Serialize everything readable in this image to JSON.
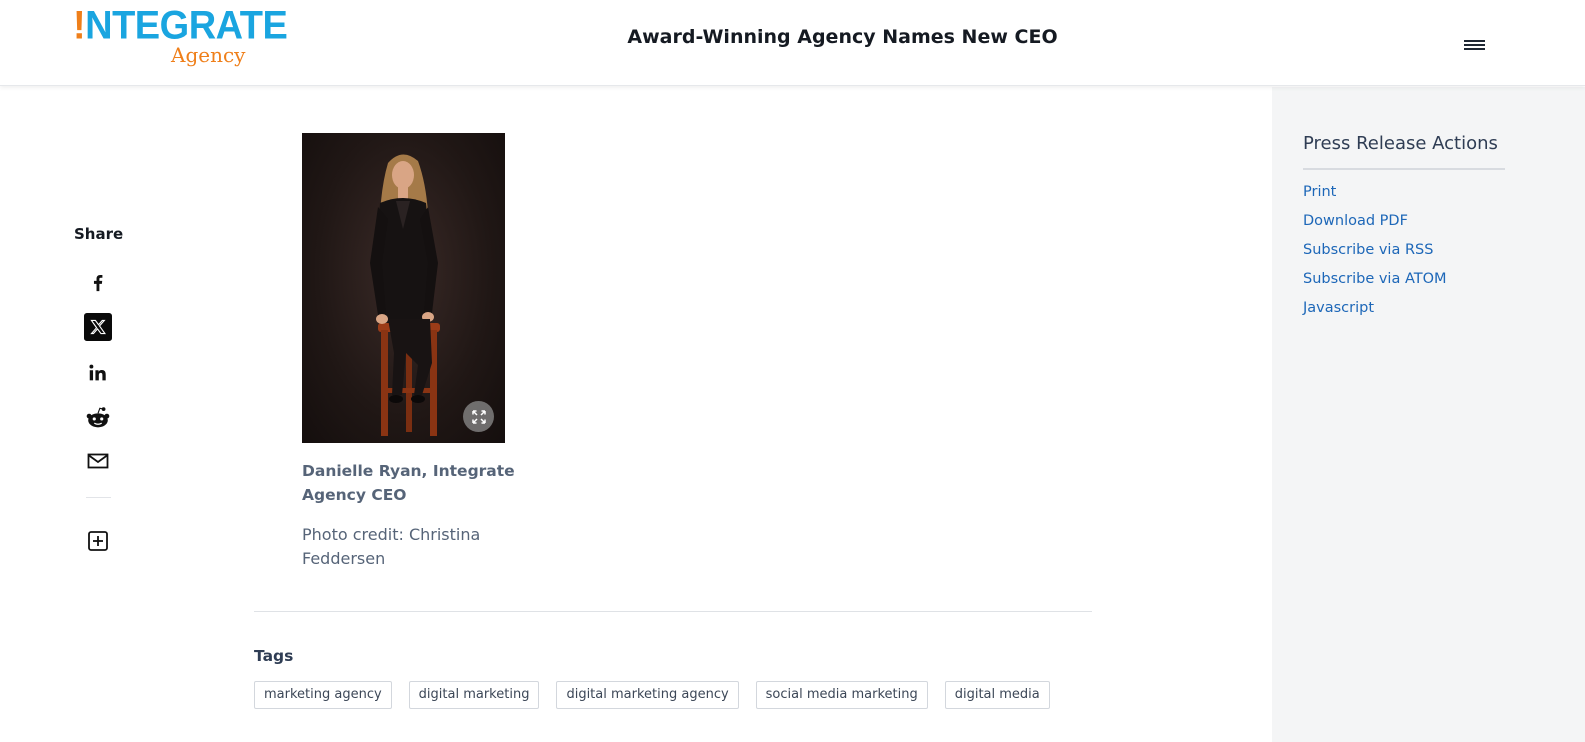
{
  "header": {
    "logo": {
      "bang": "!",
      "main": "NTEGRATE",
      "sub": "Agency"
    },
    "page_title": "Award-Winning Agency Names New CEO",
    "menu_icon": "hamburger-menu-icon"
  },
  "share": {
    "label": "Share",
    "icons": [
      "facebook-icon",
      "x-twitter-icon",
      "linkedin-icon",
      "reddit-icon",
      "email-icon",
      "add-more-icon"
    ]
  },
  "media": {
    "caption": "Danielle Ryan, Integrate Agency CEO",
    "credit": "Photo credit: Christina Feddersen",
    "expand_icon": "expand-icon"
  },
  "tags": {
    "title": "Tags",
    "items": [
      "marketing agency",
      "digital marketing",
      "digital marketing agency",
      "social media marketing",
      "digital media"
    ]
  },
  "sidebar": {
    "title": "Press Release Actions",
    "actions": [
      "Print",
      "Download PDF",
      "Subscribe via RSS",
      "Subscribe via ATOM",
      "Javascript"
    ]
  },
  "colors": {
    "logo_blue": "#1aa5e0",
    "logo_orange": "#ef7f1a",
    "link_blue": "#1d67b8",
    "sidebar_bg": "#f4f5f6"
  }
}
